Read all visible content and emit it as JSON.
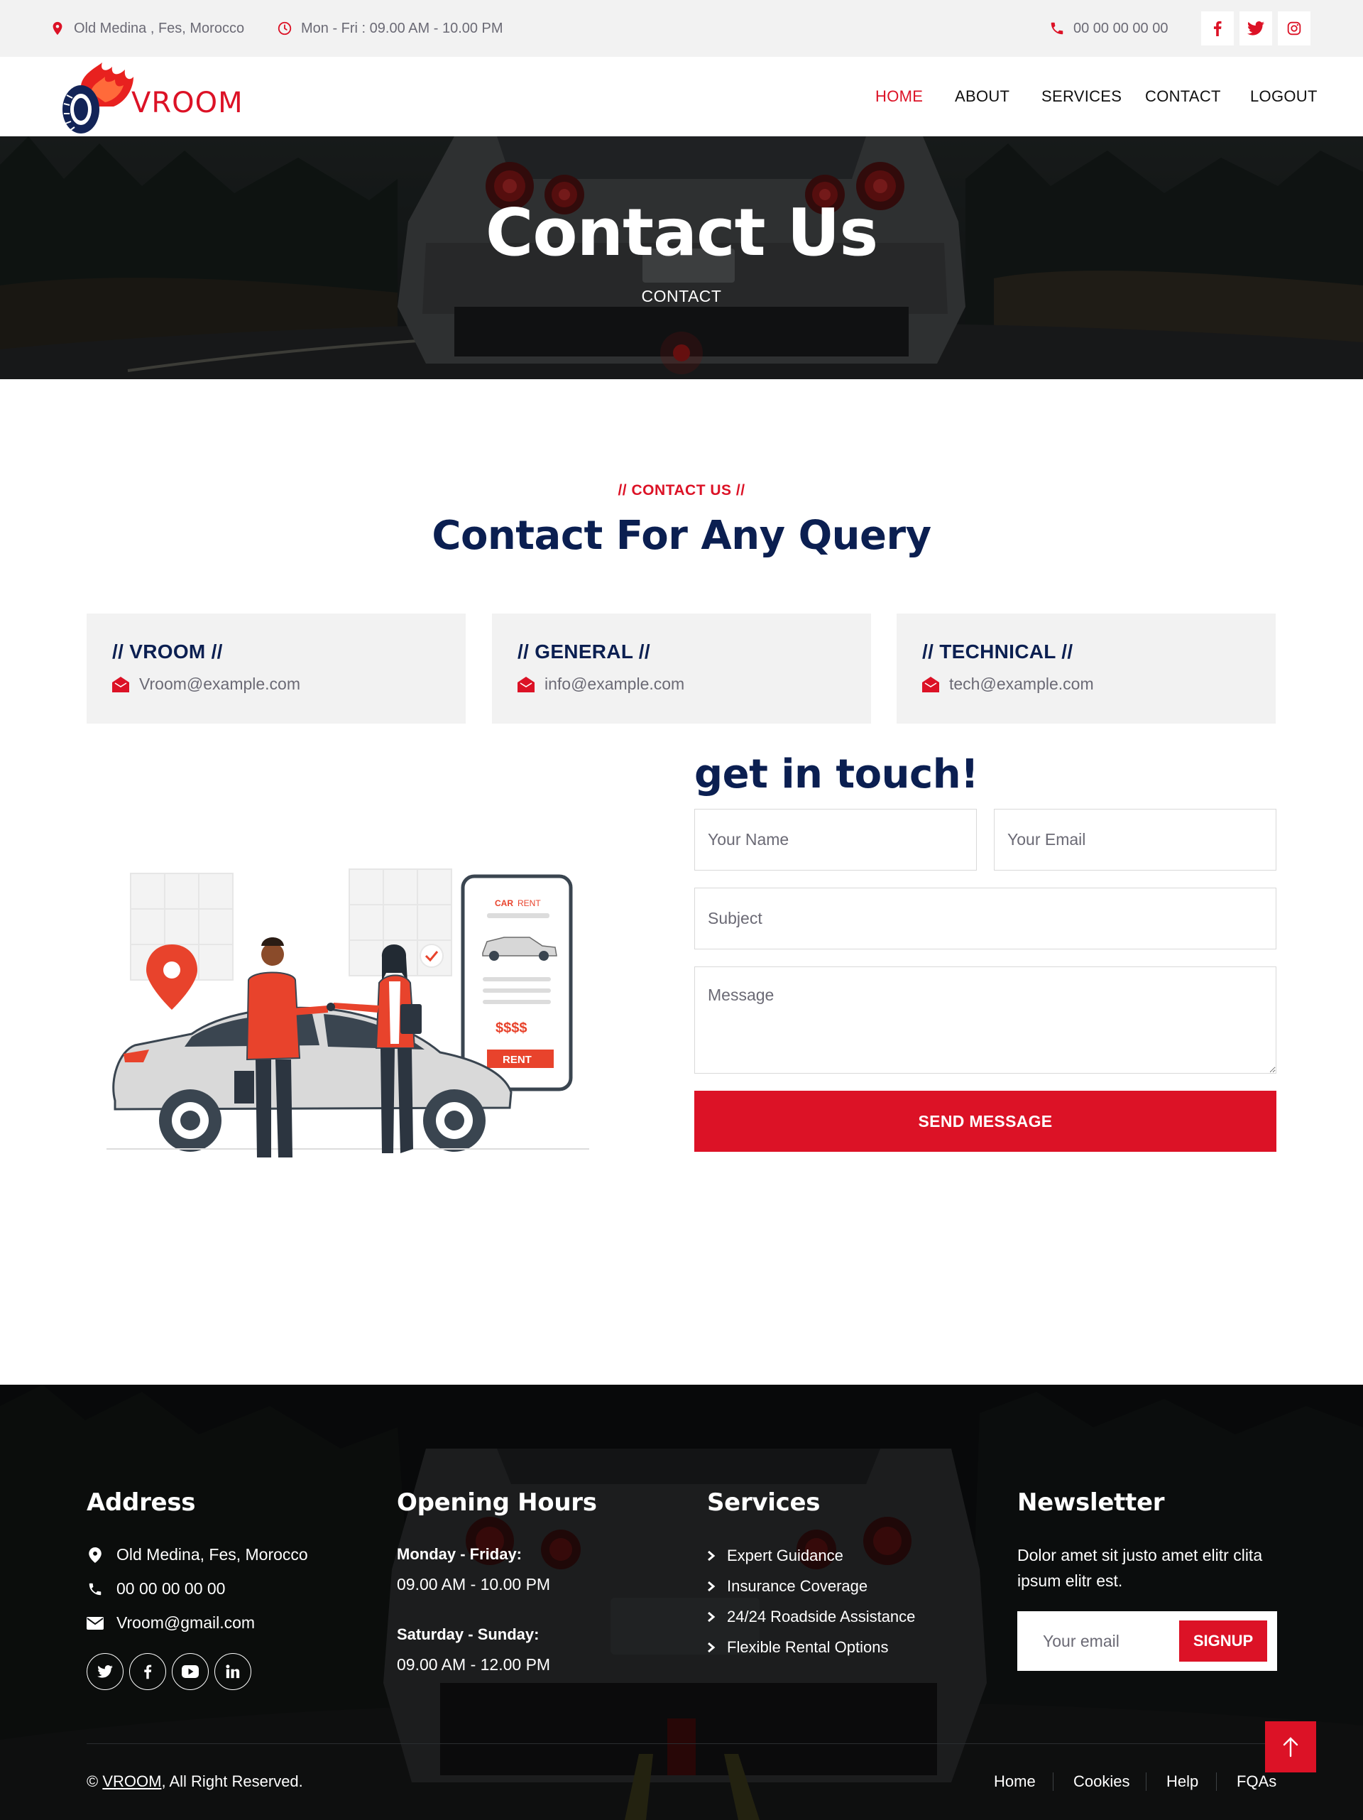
{
  "topbar": {
    "address": "Old Medina , Fes, Morocco",
    "hours": "Mon - Fri : 09.00 AM - 10.00 PM",
    "phone": "00 00 00 00 00"
  },
  "brand": {
    "name": "VROOM"
  },
  "nav": {
    "home": "HOME",
    "about": "ABOUT",
    "services": "SERVICES",
    "contact": "CONTACT",
    "logout": "LOGOUT"
  },
  "hero": {
    "title": "Contact Us",
    "breadcrumb": "CONTACT"
  },
  "section": {
    "eyebrow": "// CONTACT US //",
    "title": "Contact For Any Query"
  },
  "cards": [
    {
      "title": "// VROOM //",
      "email": "Vroom@example.com"
    },
    {
      "title": "// GENERAL //",
      "email": "info@example.com"
    },
    {
      "title": "// TECHNICAL //",
      "email": "tech@example.com"
    }
  ],
  "illustration": {
    "card_label_car": "CAR",
    "card_label_rent": "RENT",
    "price": "$$$$",
    "button": "RENT"
  },
  "form": {
    "title": "get in touch!",
    "name_placeholder": "Your Name",
    "email_placeholder": "Your Email",
    "subject_placeholder": "Subject",
    "message_placeholder": "Message",
    "submit": "SEND MESSAGE"
  },
  "footer": {
    "address_title": "Address",
    "address": "Old Medina, Fes, Morocco",
    "phone": "00 00 00 00 00",
    "email": "Vroom@gmail.com",
    "hours_title": "Opening Hours",
    "weekday_label": "Monday - Friday:",
    "weekday_hours": "09.00 AM - 10.00 PM",
    "weekend_label": "Saturday - Sunday:",
    "weekend_hours": "09.00 AM - 12.00 PM",
    "services_title": "Services",
    "services": [
      "Expert Guidance",
      "Insurance Coverage",
      "24/24 Roadside Assistance",
      "Flexible Rental Options"
    ],
    "newsletter_title": "Newsletter",
    "newsletter_text": "Dolor amet sit justo amet elitr clita ipsum elitr est.",
    "newsletter_placeholder": "Your email",
    "newsletter_button": "SIGNUP",
    "copyright_prefix": "©",
    "copyright_brand": "VROOM",
    "copyright_suffix": ", All Right Reserved.",
    "links": [
      "Home",
      "Cookies",
      "Help",
      "FQAs"
    ]
  },
  "colors": {
    "accent": "#dc1226",
    "navy": "#0b1f51",
    "topbar_bg": "#f2f2f2",
    "footer_bg": "#0d0f10"
  }
}
